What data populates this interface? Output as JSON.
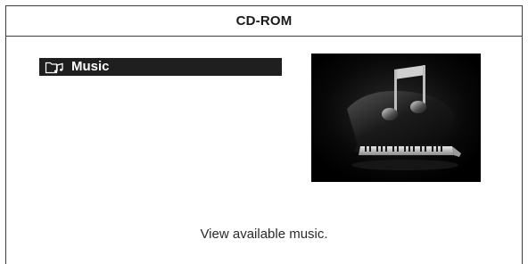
{
  "header": {
    "title": "CD-ROM"
  },
  "menu": {
    "items": [
      {
        "label": "Music",
        "icon": "music-folder-icon",
        "selected": true
      }
    ]
  },
  "preview": {
    "image": "piano-with-music-note"
  },
  "caption": {
    "text": "View available music."
  },
  "colors": {
    "selected_bg": "#1f1f1f",
    "selected_fg": "#ffffff",
    "border": "#3c3c3c",
    "preview_bg": "#000000"
  }
}
